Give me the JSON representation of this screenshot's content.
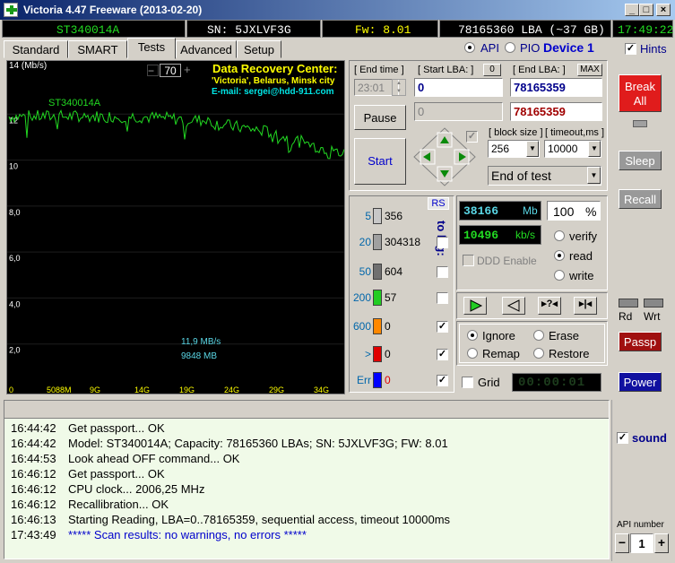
{
  "window": {
    "title": "Victoria 4.47  Freeware (2013-02-20)"
  },
  "statusbar": {
    "model": "ST340014A",
    "serial": "SN: 5JXLVF3G",
    "firmware": "Fw: 8.01",
    "lba": "78165360 LBA (~37 GB)",
    "time": "17:49:22"
  },
  "tabs": [
    "Standard",
    "SMART",
    "Tests",
    "Advanced",
    "Setup"
  ],
  "active_tab": "Tests",
  "api": {
    "api_label": "API",
    "pio_label": "PIO",
    "device": "Device 1",
    "hints_label": "Hints"
  },
  "graph": {
    "y_unit": "14 (Mb/s)",
    "y_ticks": [
      "12",
      "10",
      "8,0",
      "6,0",
      "4,0",
      "2,0"
    ],
    "x_ticks": [
      "0",
      "5088M",
      "9G",
      "14G",
      "19G",
      "24G",
      "29G",
      "34G"
    ],
    "zoom_value": "70",
    "zoom_minus": "−",
    "zoom_plus": "+",
    "drive_label": "ST340014A",
    "drc_title": "Data Recovery Center:",
    "drc_line1": "'Victoria', Belarus, Minsk city",
    "drc_line2": "E-mail: sergei@hdd-911.com",
    "speed": "11,9 MB/s",
    "size": "9848 MB",
    "trace_color": "#22d822"
  },
  "controls": {
    "end_time_label": "[ End time ]",
    "end_time_value": "23:01",
    "start_lba_label": "[ Start LBA: ]",
    "start_lba_btn": "0",
    "start_lba_value": "0",
    "start_lba_value2": "0",
    "end_lba_label": "[ End LBA: ]",
    "end_lba_btn": "MAX",
    "end_lba_value": "78165359",
    "end_lba_value2": "78165359",
    "pause": "Pause",
    "start": "Start",
    "block_size_label": "[ block size ]",
    "block_size": "256",
    "timeout_label": "[ timeout,ms ]",
    "timeout": "10000",
    "end_action": "End of test"
  },
  "stats": {
    "rs": "RS",
    "to_log": "to log:",
    "rows": [
      {
        "label": "5",
        "count": "356",
        "color": "#c8c8c8",
        "checked": false
      },
      {
        "label": "20",
        "count": "304318",
        "color": "#a0a0a0",
        "checked": false
      },
      {
        "label": "50",
        "count": "604",
        "color": "#707070",
        "checked": false
      },
      {
        "label": "200",
        "count": "57",
        "color": "#22cc22",
        "checked": false
      },
      {
        "label": "600",
        "count": "0",
        "color": "#ff8800",
        "checked": true
      },
      {
        "label": ">",
        "count": "0",
        "color": "#e00000",
        "checked": true
      },
      {
        "label": "Err",
        "count": "0",
        "color": "#0000ff",
        "checked": true
      }
    ]
  },
  "progress": {
    "mb": "38166",
    "mb_unit": "Mb",
    "percent": "100",
    "percent_unit": "%",
    "speed": "10496",
    "speed_unit": "kb/s",
    "ddd": "DDD Enable",
    "verify": "verify",
    "read": "read",
    "write": "write",
    "ignore": "Ignore",
    "erase": "Erase",
    "remap": "Remap",
    "restore": "Restore",
    "grid": "Grid",
    "timer": "00:00:01"
  },
  "right": {
    "break_all": "Break\nAll",
    "sleep": "Sleep",
    "recall": "Recall",
    "rd": "Rd",
    "wrt": "Wrt",
    "passp": "Passp",
    "power": "Power",
    "sound": "sound",
    "api_number_label": "API number",
    "api_number": "1",
    "minus": "−",
    "plus": "+"
  },
  "log": [
    {
      "time": "16:44:42",
      "msg": "Get passport... OK"
    },
    {
      "time": "16:44:42",
      "msg": "Model: ST340014A; Capacity: 78165360 LBAs; SN: 5JXLVF3G; FW: 8.01"
    },
    {
      "time": "16:44:53",
      "msg": "Look ahead OFF command... OK"
    },
    {
      "time": "16:46:12",
      "msg": "Get passport... OK"
    },
    {
      "time": "16:46:12",
      "msg": "CPU clock... 2006,25 MHz"
    },
    {
      "time": "16:46:12",
      "msg": "Recallibration... OK"
    },
    {
      "time": "16:46:13",
      "msg": "Starting Reading, LBA=0..78165359, sequential access, timeout 10000ms"
    },
    {
      "time": "17:43:49",
      "msg": "***** Scan results: no warnings, no errors *****",
      "color": "#0000cc"
    }
  ]
}
